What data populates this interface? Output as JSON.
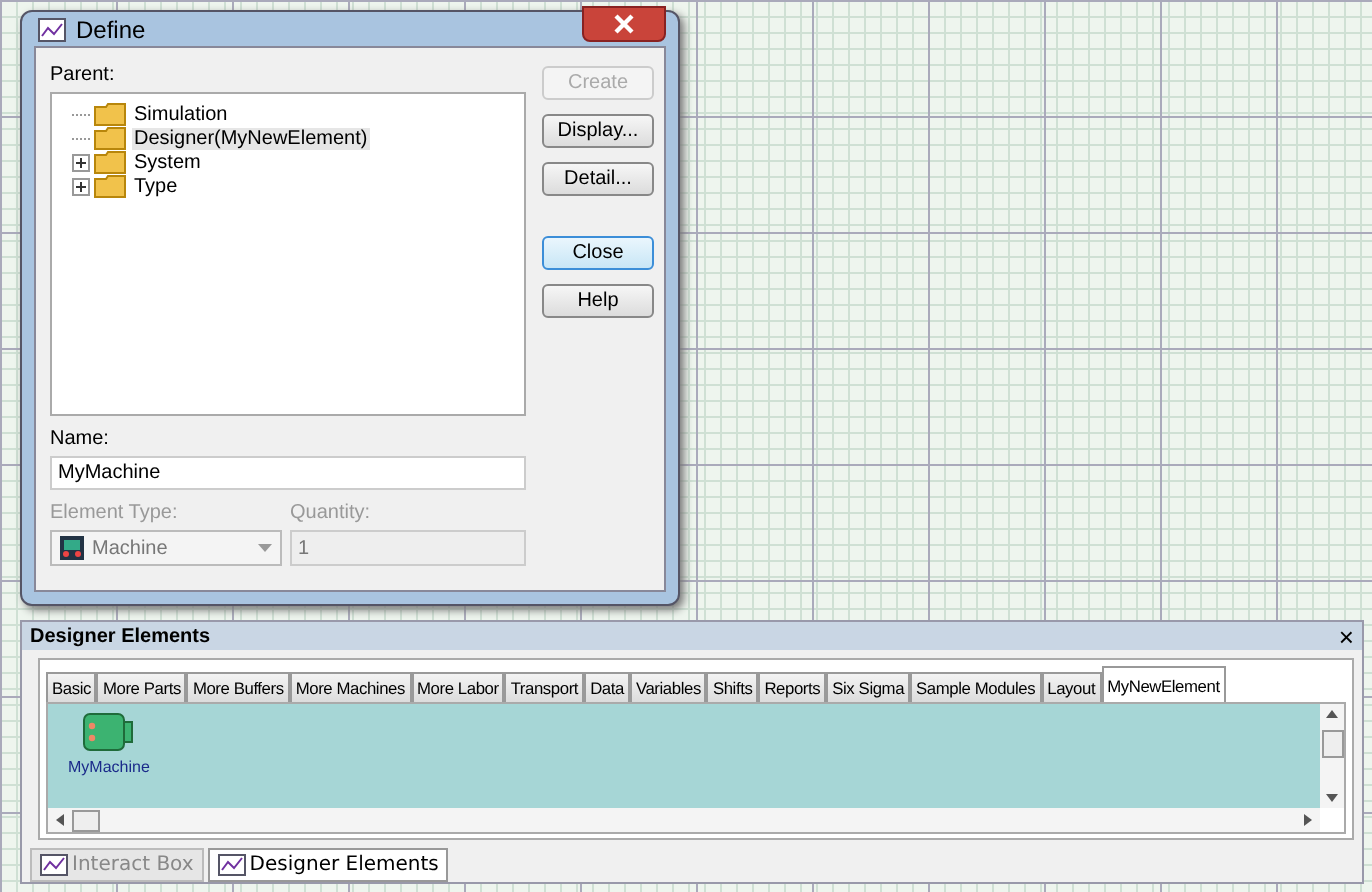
{
  "dialog": {
    "title": "Define",
    "parent_label": "Parent:",
    "tree": [
      {
        "label": "Simulation",
        "kind": "leaf",
        "selected": false
      },
      {
        "label": "Designer(MyNewElement)",
        "kind": "leaf",
        "selected": true
      },
      {
        "label": "System",
        "kind": "branch",
        "expanded": false,
        "selected": false
      },
      {
        "label": "Type",
        "kind": "branch",
        "expanded": false,
        "selected": false
      }
    ],
    "name_label": "Name:",
    "name_value": "MyMachine",
    "element_type_label": "Element Type:",
    "element_type_value": "Machine",
    "element_type_disabled": true,
    "quantity_label": "Quantity:",
    "quantity_value": "1",
    "quantity_disabled": true,
    "buttons": [
      {
        "label": "Create",
        "disabled": true,
        "default": false
      },
      {
        "label": "Display...",
        "disabled": false,
        "default": false
      },
      {
        "label": "Detail...",
        "disabled": false,
        "default": false
      },
      {
        "label": "Close",
        "disabled": false,
        "default": true
      },
      {
        "label": "Help",
        "disabled": false,
        "default": false
      }
    ]
  },
  "panel": {
    "title": "Designer Elements",
    "close": "×",
    "tabs": [
      {
        "label": "Basic",
        "selected": false
      },
      {
        "label": "More Parts",
        "selected": false
      },
      {
        "label": "More Buffers",
        "selected": false
      },
      {
        "label": "More Machines",
        "selected": false
      },
      {
        "label": "More Labor",
        "selected": false
      },
      {
        "label": "Transport",
        "selected": false
      },
      {
        "label": "Data",
        "selected": false
      },
      {
        "label": "Variables",
        "selected": false
      },
      {
        "label": "Shifts",
        "selected": false
      },
      {
        "label": "Reports",
        "selected": false
      },
      {
        "label": "Six Sigma",
        "selected": false
      },
      {
        "label": "Sample Modules",
        "selected": false
      },
      {
        "label": "Layout",
        "selected": false
      },
      {
        "label": "MyNewElement",
        "selected": true
      }
    ],
    "elements": [
      {
        "label": "MyMachine"
      }
    ],
    "bottom_tabs": [
      {
        "label": "Interact Box",
        "selected": false
      },
      {
        "label": "Designer Elements",
        "selected": true
      }
    ]
  }
}
